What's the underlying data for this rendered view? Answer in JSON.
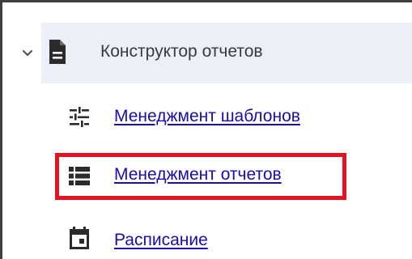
{
  "section": {
    "title": "Конструктор отчетов",
    "expanded": true
  },
  "nav": {
    "items": [
      {
        "label": "Менеджмент шаблонов",
        "icon": "sliders-icon"
      },
      {
        "label": "Менеджмент отчетов",
        "icon": "list-icon",
        "highlighted": true
      },
      {
        "label": "Расписание",
        "icon": "calendar-icon"
      }
    ]
  },
  "colors": {
    "link": "#1a0dab",
    "highlight": "#e3141f",
    "header_bg": "#eceff7",
    "text": "#3a3a3a"
  }
}
